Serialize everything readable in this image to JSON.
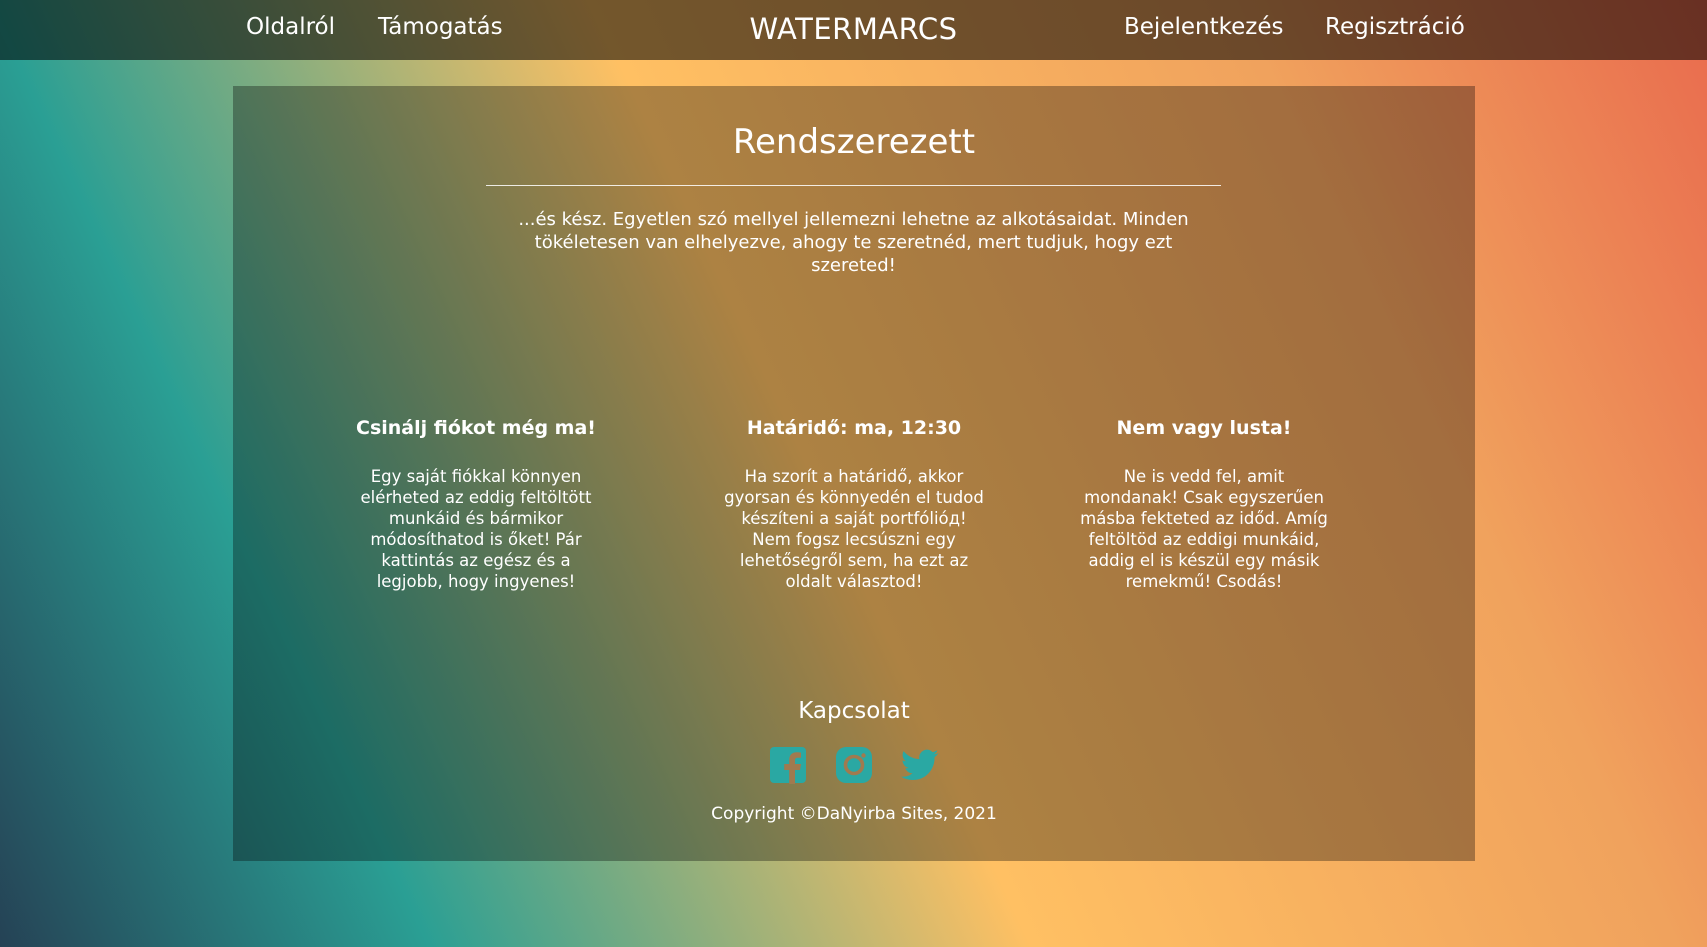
{
  "nav": {
    "about": "Oldalról",
    "support": "Támogatás",
    "brand": "WATERMARCS",
    "login": "Bejelentkezés",
    "register": "Regisztráció"
  },
  "hero": {
    "title": "Rendszerezett",
    "text": "...és kész. Egyetlen szó mellyel jellemezni lehetne az alkotásaidat. Minden tökéletesen van elhelyezve, ahogy te szeretnéd, mert tudjuk, hogy ezt szereted!"
  },
  "features": [
    {
      "title": "Csinálj fiókot még ma!",
      "text": "Egy saját fiókkal könnyen elérheted az eddig feltöltött munkáid és bármikor módosíthatod is őket! Pár kattintás az egész és a legjobb, hogy ingyenes!"
    },
    {
      "title": "Határidő: ma, 12:30",
      "text": "Ha szorít a határidő, akkor gyorsan és könnyedén el tudod készíteni a saját portfólióд! Nem fogsz lecsúszni egy lehetőségről sem, ha ezt az oldalt választod!"
    },
    {
      "title": "Nem vagy lusta!",
      "text": "Ne is vedd fel, amit mondanak! Csak egyszerűen másba fekteted az időd. Amíg feltöltöd az eddigi munkáid, addig el is készül egy másik remekmű! Csodás!"
    }
  ],
  "contact": {
    "title": "Kapcsolat",
    "icons": [
      "facebook-icon",
      "instagram-icon",
      "twitter-icon"
    ],
    "icon_color": "#2aa8a3"
  },
  "footer": {
    "copyright": "Copyright ©DaNyirba Sites, 2021"
  },
  "colors": {
    "gradient": [
      "#254255",
      "#2a9f94",
      "#ffc063",
      "#f0a25d",
      "#e96b4e"
    ],
    "topbar": "rgba(0,0,0,0.55)",
    "panel": "rgba(0,0,0,0.32)"
  }
}
